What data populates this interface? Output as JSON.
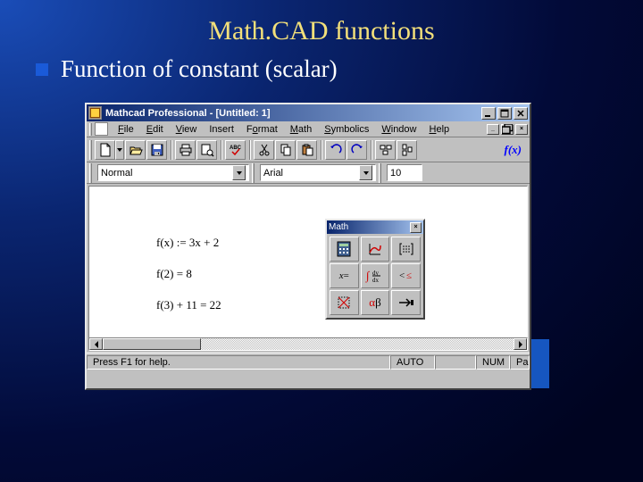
{
  "slide": {
    "title": "Math.CAD functions",
    "bullet": "Function of constant (scalar)"
  },
  "window": {
    "title": "Mathcad Professional - [Untitled: 1]"
  },
  "menu": {
    "file": "File",
    "edit": "Edit",
    "view": "View",
    "insert": "Insert",
    "format": "Format",
    "math": "Math",
    "symbolics": "Symbolics",
    "window": "Window",
    "help": "Help"
  },
  "format_bar": {
    "style": "Normal",
    "font": "Arial",
    "size": "10"
  },
  "equations": {
    "e1": "f(x)  := 3x + 2",
    "e2": "f(2)  = 8",
    "e3": "f(3)  + 11 = 22"
  },
  "math_palette": {
    "title": "Math"
  },
  "status": {
    "help": "Press F1 for help.",
    "auto": "AUTO",
    "num": "NUM",
    "page": "Pa"
  },
  "fx_label": "f(x)"
}
